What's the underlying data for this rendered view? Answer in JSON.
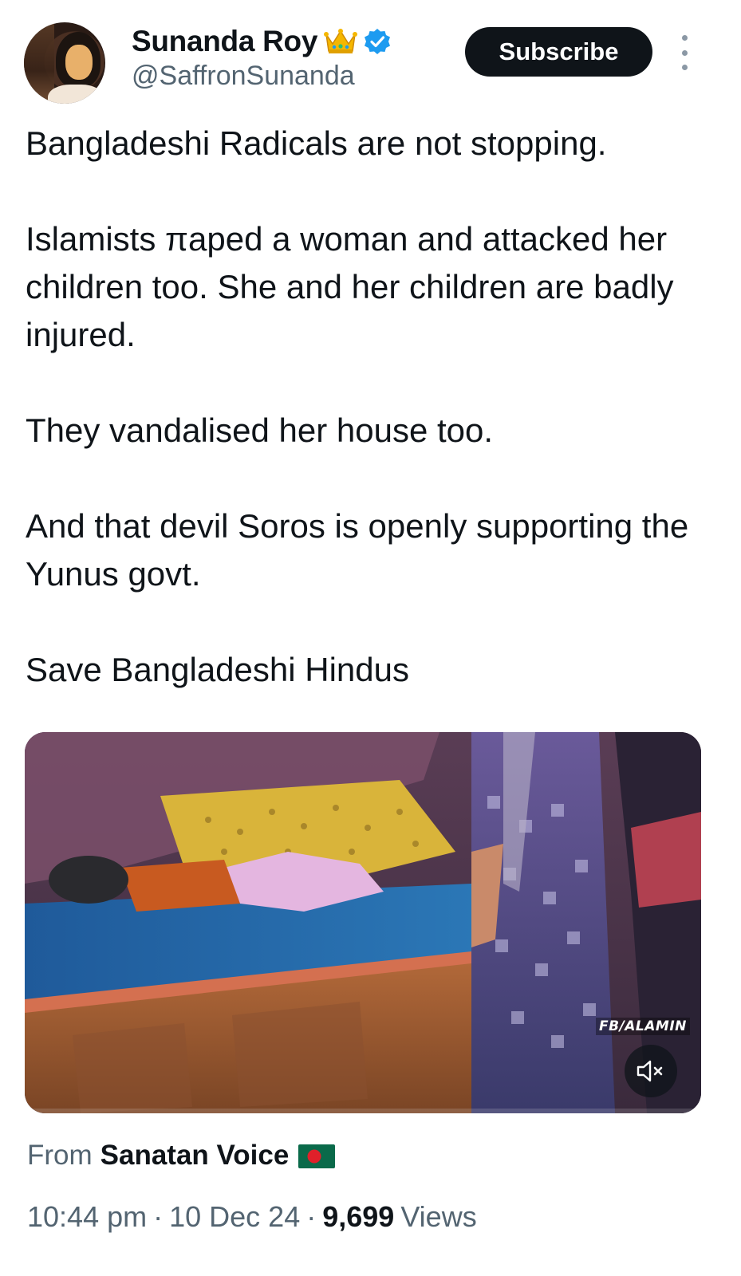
{
  "author": {
    "display_name": "Sunanda Roy",
    "handle": "@SaffronSunanda",
    "avatar_icon": "user-avatar-photo",
    "badges": [
      "crown-icon",
      "verified-icon"
    ],
    "verified_color": "#1d9bf0"
  },
  "actions": {
    "subscribe_label": "Subscribe",
    "more_icon": "more-options-icon"
  },
  "tweet": {
    "paragraphs": [
      "Bangladeshi Radicals are not stopping.",
      "Islamists πaped a woman and attacked her children too. She and her children are badly injured.",
      "They vandalised her house too.",
      "And that devil Soros is openly supporting the Yunus govt.",
      "Save Bangladeshi Hindus"
    ]
  },
  "media": {
    "type": "video",
    "watermark": "FB/ALAMIN",
    "mute_icon": "speaker-muted-icon"
  },
  "source": {
    "label": "From",
    "name": "Sanatan Voice",
    "flag_icon": "bangladesh-flag-icon"
  },
  "meta": {
    "time": "10:44 pm",
    "separator": "·",
    "date": "10 Dec 24",
    "views_count": "9,699",
    "views_label": "Views"
  },
  "colors": {
    "text_primary": "#0f1419",
    "text_secondary": "#536471",
    "button_bg": "#0f1419",
    "button_text": "#ffffff"
  }
}
